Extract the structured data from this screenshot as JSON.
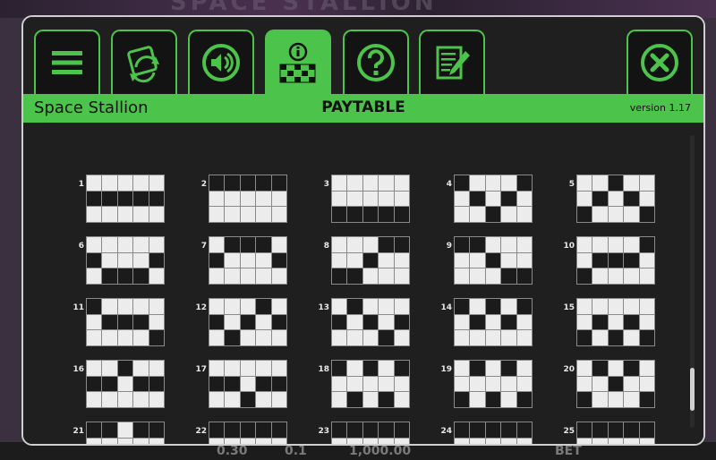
{
  "background": {
    "title_fragment": "SPACE STALLION",
    "bottom_values": [
      "0.30",
      "0.1",
      "1,000.00",
      "BET"
    ]
  },
  "tabs": [
    {
      "icon": "menu-icon",
      "active": false
    },
    {
      "icon": "autoplay-icon",
      "active": false
    },
    {
      "icon": "sound-icon",
      "active": false
    },
    {
      "icon": "paytable-info-icon",
      "active": true
    },
    {
      "icon": "help-icon",
      "active": false
    },
    {
      "icon": "history-icon",
      "active": false
    },
    {
      "icon": "close-icon",
      "active": false
    }
  ],
  "header": {
    "game_name": "Space Stallion",
    "page_title": "PAYTABLE",
    "version": "version 1.17"
  },
  "colors": {
    "accent": "#4cc34a",
    "panel": "#1f1f1f",
    "cell_on": "#ececec",
    "cell_off": "#1b1b1b"
  },
  "paylines": [
    {
      "label": "1",
      "rows": [
        1,
        1,
        1,
        1,
        1
      ]
    },
    {
      "label": "2",
      "rows": [
        0,
        0,
        0,
        0,
        0
      ]
    },
    {
      "label": "3",
      "rows": [
        2,
        2,
        2,
        2,
        2
      ]
    },
    {
      "label": "4",
      "rows": [
        0,
        1,
        2,
        1,
        0
      ]
    },
    {
      "label": "5",
      "rows": [
        2,
        1,
        0,
        1,
        2
      ]
    },
    {
      "label": "6",
      "rows": [
        1,
        2,
        2,
        2,
        1
      ]
    },
    {
      "label": "7",
      "rows": [
        1,
        0,
        0,
        0,
        1
      ]
    },
    {
      "label": "8",
      "rows": [
        2,
        2,
        1,
        0,
        0
      ]
    },
    {
      "label": "9",
      "rows": [
        0,
        0,
        1,
        2,
        2
      ]
    },
    {
      "label": "10",
      "rows": [
        2,
        1,
        1,
        1,
        0
      ]
    },
    {
      "label": "11",
      "rows": [
        0,
        1,
        1,
        1,
        2
      ]
    },
    {
      "label": "12",
      "rows": [
        1,
        2,
        1,
        0,
        1
      ]
    },
    {
      "label": "13",
      "rows": [
        1,
        0,
        1,
        2,
        1
      ]
    },
    {
      "label": "14",
      "rows": [
        0,
        1,
        0,
        1,
        0
      ]
    },
    {
      "label": "15",
      "rows": [
        2,
        1,
        2,
        1,
        2
      ]
    },
    {
      "label": "16",
      "rows": [
        1,
        1,
        0,
        1,
        1
      ]
    },
    {
      "label": "17",
      "rows": [
        1,
        1,
        2,
        1,
        1
      ]
    },
    {
      "label": "18",
      "rows": [
        0,
        2,
        0,
        2,
        0
      ]
    },
    {
      "label": "19",
      "rows": [
        2,
        0,
        2,
        0,
        2
      ]
    },
    {
      "label": "20",
      "rows": [
        2,
        0,
        1,
        0,
        2
      ]
    },
    {
      "label": "21",
      "rows": [
        0,
        0,
        2,
        0,
        0
      ]
    },
    {
      "label": "22",
      "rows": [
        0,
        0,
        0,
        0,
        0
      ]
    },
    {
      "label": "23",
      "rows": [
        0,
        0,
        0,
        0,
        0
      ]
    },
    {
      "label": "24",
      "rows": [
        0,
        0,
        0,
        0,
        0
      ]
    },
    {
      "label": "25",
      "rows": [
        0,
        0,
        0,
        0,
        0
      ]
    }
  ]
}
